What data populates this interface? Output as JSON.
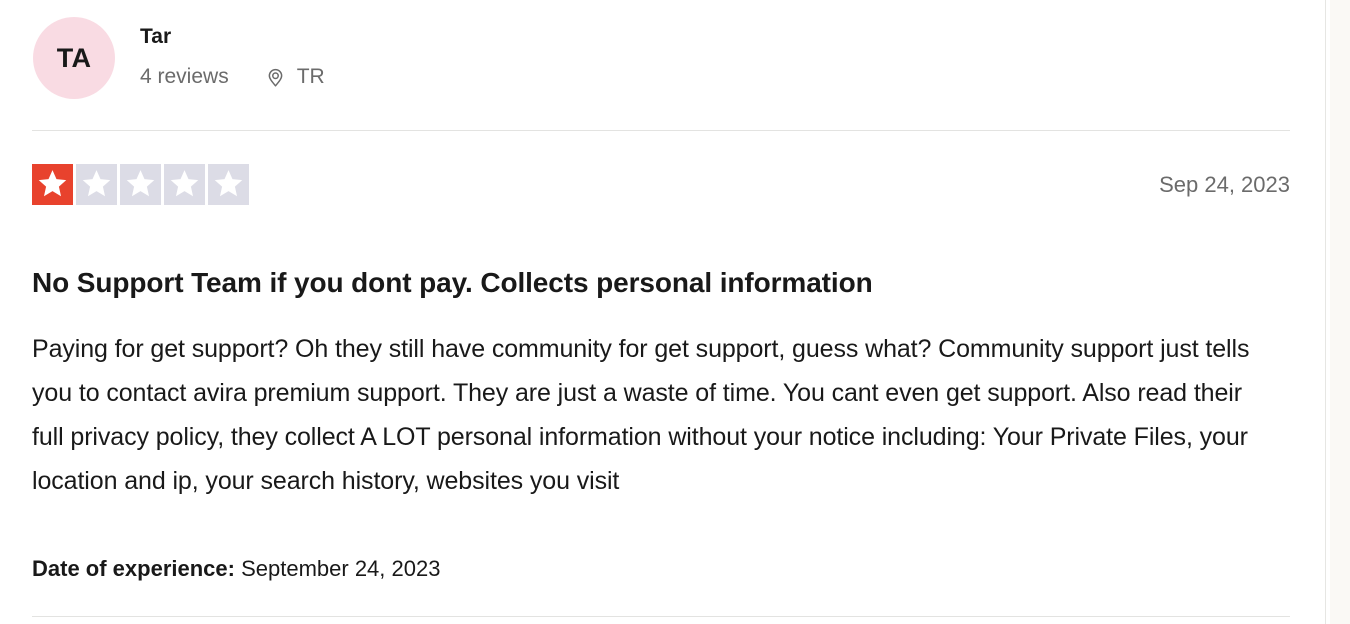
{
  "review": {
    "consumer": {
      "initials": "TA",
      "name": "Tar",
      "review_count": "4 reviews",
      "location_code": "TR",
      "location_icon": "map-pin-icon",
      "avatar_color": "#F9DBE3"
    },
    "rating": {
      "value": 1,
      "max": 5,
      "filled_color": "#E8422D",
      "empty_color": "#DCDCE6"
    },
    "date": "Sep 24, 2023",
    "title": "No Support Team if you dont pay. Collects personal information",
    "body": "Paying for get support? Oh they still have community for get support, guess what? Community support just tells you to contact avira premium support. They are just a waste of time. You cant even get support. Also read their full privacy policy, they collect A LOT personal information without your notice including: Your Private Files, your location and ip, your search history, websites you visit",
    "experience": {
      "label": "Date of experience:",
      "value": "September 24, 2023"
    }
  }
}
